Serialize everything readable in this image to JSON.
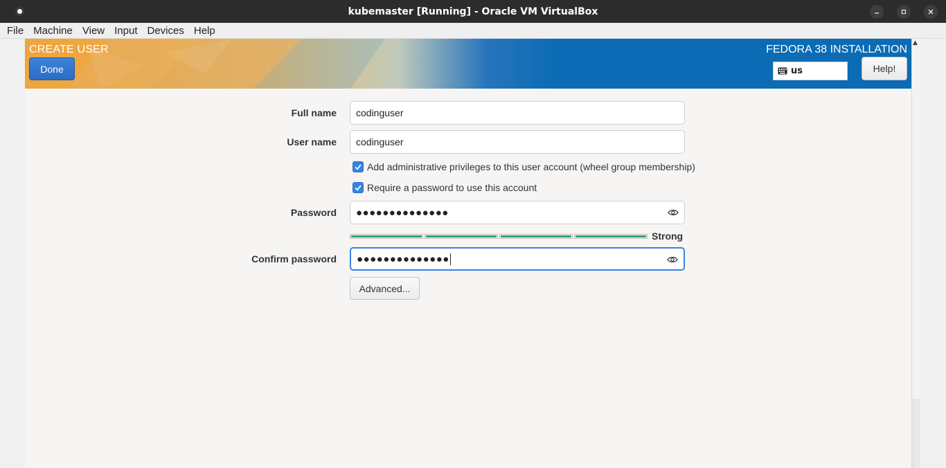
{
  "window": {
    "title": "kubemaster [Running] - Oracle VM VirtualBox"
  },
  "menu": [
    "File",
    "Machine",
    "View",
    "Input",
    "Devices",
    "Help"
  ],
  "header": {
    "spoke_title": "CREATE USER",
    "done_label": "Done",
    "product_title": "FEDORA 38 INSTALLATION",
    "keyboard_layout": "us",
    "help_label": "Help!"
  },
  "form": {
    "full_name_label": "Full name",
    "full_name_value": "codinguser",
    "user_name_label": "User name",
    "user_name_value": "codinguser",
    "admin_checkbox_label": "Add administrative privileges to this user account (wheel group membership)",
    "admin_checked": true,
    "require_password_label": "Require a password to use this account",
    "require_password_checked": true,
    "password_label": "Password",
    "password_mask": "●●●●●●●●●●●●●●",
    "strength_label": "Strong",
    "strength_fraction": 1.0,
    "confirm_label": "Confirm password",
    "confirm_mask": "●●●●●●●●●●●●●●",
    "advanced_label": "Advanced..."
  },
  "colors": {
    "accent_blue": "#3584e4",
    "header_blue": "#0b6bb4",
    "strength_green": "#26a269"
  },
  "icons": {
    "app": "virtualbox-record-icon",
    "keyboard": "keyboard-icon",
    "eye": "eye-icon"
  }
}
